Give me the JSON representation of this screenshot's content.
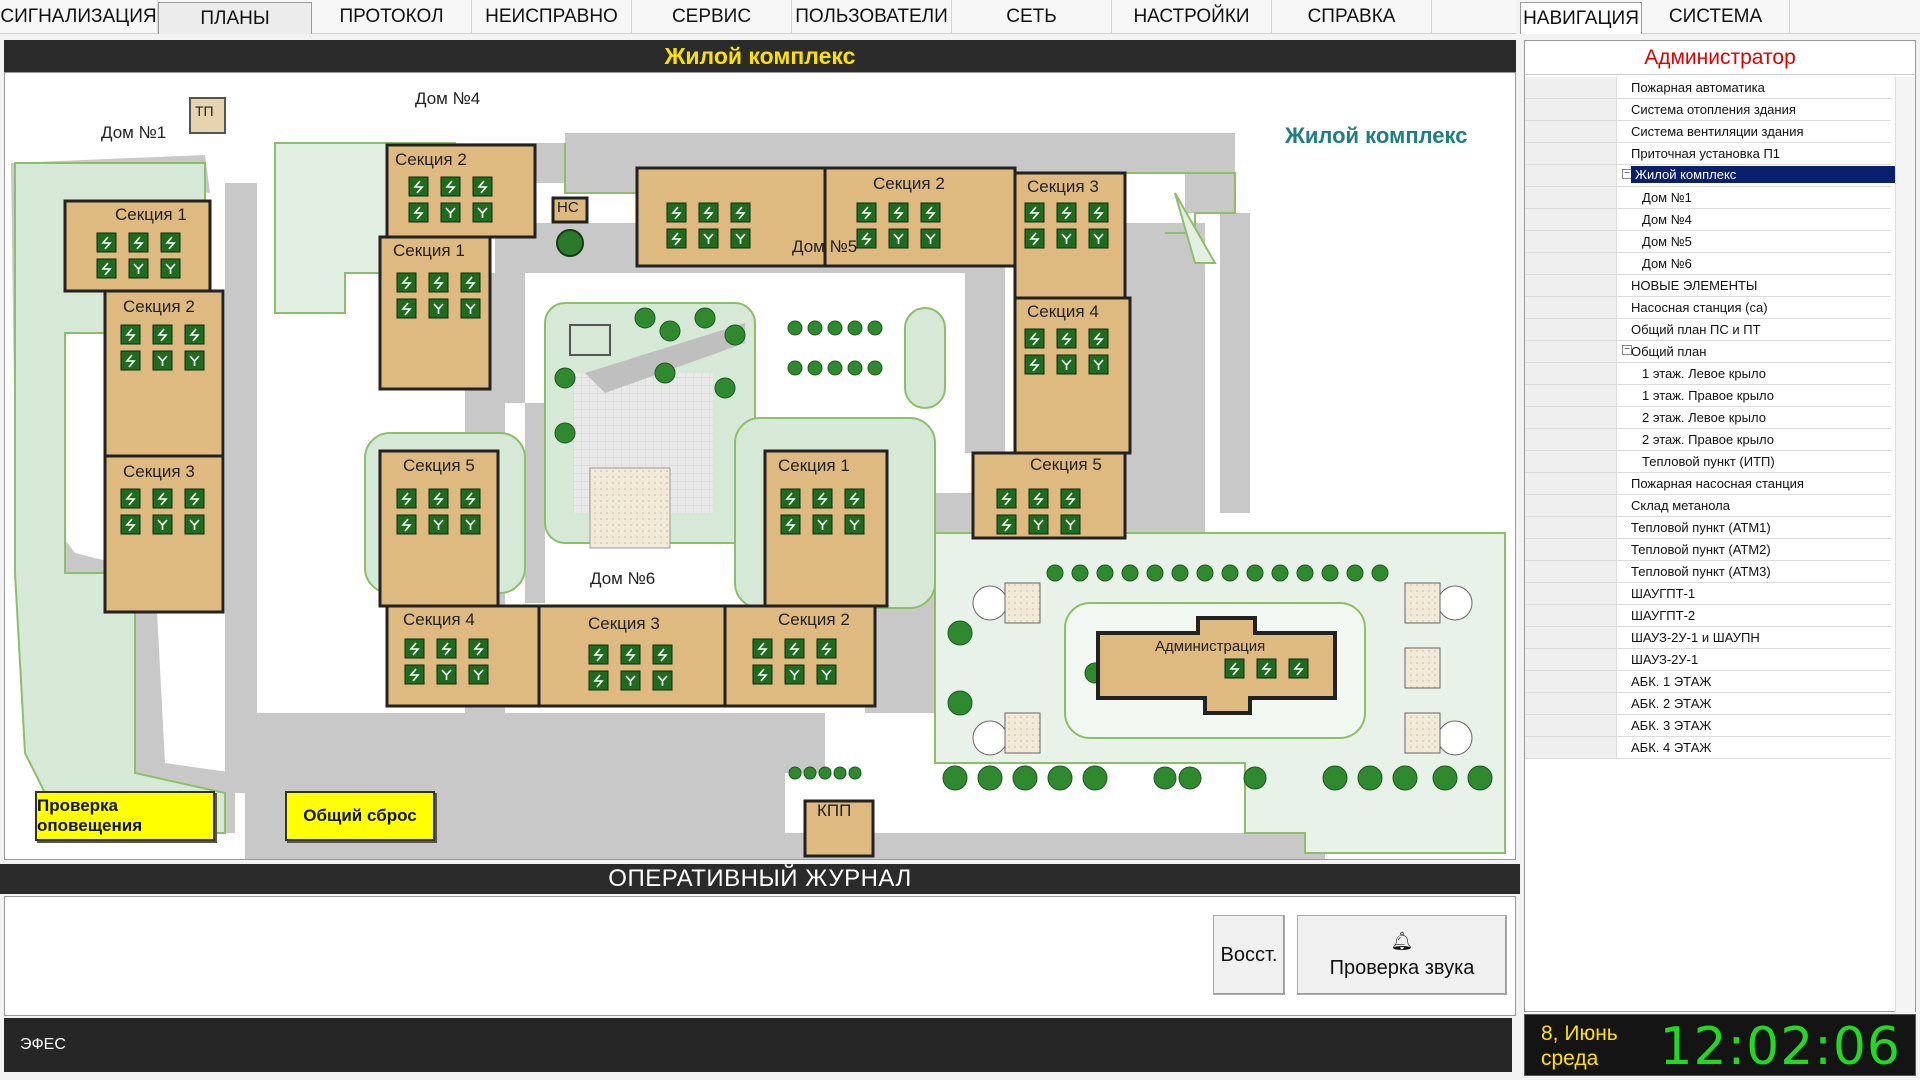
{
  "top_menu": [
    "СИГНАЛИЗАЦИЯ",
    "ПЛАНЫ",
    "ПРОТОКОЛ",
    "НЕИСПРАВНО",
    "СЕРВИС",
    "ПОЛЬЗОВАТЕЛИ",
    "СЕТЬ",
    "НАСТРОЙКИ",
    "СПРАВКА"
  ],
  "top_menu_active": "ПЛАНЫ",
  "right_menu": [
    "НАВИГАЦИЯ",
    "СИСТЕМА"
  ],
  "right_menu_active": "НАВИГАЦИЯ",
  "map": {
    "title": "Жилой комплекс",
    "complex_label": "Жилой комплекс",
    "labels": {
      "house1": "Дом №1",
      "house4": "Дом №4",
      "house5": "Дом №5",
      "house6": "Дом №6",
      "tp": "ТП",
      "ns": "НС",
      "kpp": "КПП",
      "admin": "Администрация",
      "h1_s1": "Секция 1",
      "h1_s2": "Секция 2",
      "h1_s3": "Секция 3",
      "h4_s2": "Секция 2",
      "h4_s1": "Секция 1",
      "h5_s2": "Секция 2",
      "h5_s3": "Секция 3",
      "h5_s4": "Секция 4",
      "h5_s5": "Секция 5",
      "h6_s5": "Секция 5",
      "h6_s1": "Секция 1",
      "h6_s4": "Секция 4",
      "h6_s3": "Секция 3",
      "h6_s2": "Секция 2"
    },
    "buttons": {
      "check_alert": "Проверка оповещения",
      "reset_all": "Общий сброс"
    },
    "colors": {
      "building": "#deba80",
      "road": "#c8c8c8",
      "lawn": "#d6e8d6",
      "device": "#1f6b1f",
      "title_text": "#ffe100"
    }
  },
  "journal": {
    "title": "ОПЕРАТИВНЫЙ ЖУРНАЛ",
    "restore_label": "Восст.",
    "sound_check_label": "Проверка звука",
    "sound_icon": "bell-icon"
  },
  "status_bar": {
    "text": "ЭФЕС"
  },
  "nav": {
    "user": "Администратор",
    "items": [
      {
        "label": "Пожарная автоматика",
        "level": 0
      },
      {
        "label": "Система отопления здания",
        "level": 0
      },
      {
        "label": "Система вентиляции здания",
        "level": 0
      },
      {
        "label": "Приточная установка П1",
        "level": 0
      },
      {
        "label": "Жилой комплекс",
        "level": 0,
        "expander": "⊟",
        "selected": true
      },
      {
        "label": "Дом №1",
        "level": 1
      },
      {
        "label": "Дом №4",
        "level": 1
      },
      {
        "label": "Дом №5",
        "level": 1
      },
      {
        "label": "Дом №6",
        "level": 1
      },
      {
        "label": "НОВЫЕ ЭЛЕМЕНТЫ",
        "level": 0
      },
      {
        "label": "Насосная станция (са)",
        "level": 0
      },
      {
        "label": "Общий план ПС и ПТ",
        "level": 0
      },
      {
        "label": "Общий план",
        "level": 0,
        "expander": "⊟"
      },
      {
        "label": "1 этаж. Левое крыло",
        "level": 1
      },
      {
        "label": "1 этаж. Правое крыло",
        "level": 1
      },
      {
        "label": "2 этаж. Левое крыло",
        "level": 1
      },
      {
        "label": "2 этаж. Правое крыло",
        "level": 1
      },
      {
        "label": "Тепловой пункт (ИТП)",
        "level": 1
      },
      {
        "label": "Пожарная насосная станция",
        "level": 0
      },
      {
        "label": "Склад метанола",
        "level": 0
      },
      {
        "label": "Тепловой пункт (АТМ1)",
        "level": 0
      },
      {
        "label": "Тепловой пункт (АТМ2)",
        "level": 0
      },
      {
        "label": "Тепловой пункт (АТМ3)",
        "level": 0
      },
      {
        "label": "ШАУГПТ-1",
        "level": 0
      },
      {
        "label": "ШАУГПТ-2",
        "level": 0
      },
      {
        "label": "ШАУЗ-2У-1 и ШАУПН",
        "level": 0
      },
      {
        "label": "ШАУЗ-2У-1",
        "level": 0
      },
      {
        "label": "АБК. 1 ЭТАЖ",
        "level": 0
      },
      {
        "label": "АБК. 2 ЭТАЖ",
        "level": 0
      },
      {
        "label": "АБК. 3 ЭТАЖ",
        "level": 0
      },
      {
        "label": "АБК. 4 ЭТАЖ",
        "level": 0
      }
    ]
  },
  "clock": {
    "date_line1": "8, Июнь",
    "date_line2": "среда",
    "time": "12:02:06"
  }
}
